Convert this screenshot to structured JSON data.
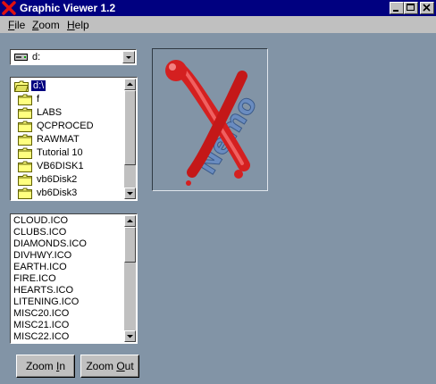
{
  "window": {
    "title": "Graphic Viewer 1.2",
    "icon": "red-x-icon"
  },
  "menu": [
    {
      "accel": "F",
      "rest": "ile"
    },
    {
      "accel": "Z",
      "rest": "oom"
    },
    {
      "accel": "H",
      "rest": "elp"
    }
  ],
  "drive": {
    "value": "d:",
    "icon": "drive-icon"
  },
  "directories": [
    "d:\\",
    "f",
    "LABS",
    "QCPROCED",
    "RAWMAT",
    "Tutorial 10",
    "VB6DISK1",
    "vb6Disk2",
    "vb6Disk3"
  ],
  "selected_directory": "d:\\",
  "files": [
    "CLOUD.ICO",
    "CLUBS.ICO",
    "DIAMONDS.ICO",
    "DIVHWY.ICO",
    "EARTH.ICO",
    "FIRE.ICO",
    "HEARTS.ICO",
    "LITENING.ICO",
    "MISC20.ICO",
    "MISC21.ICO",
    "MISC22.ICO"
  ],
  "buttons": {
    "zoom_in": {
      "pre": "Zoom ",
      "accel": "I",
      "post": "n"
    },
    "zoom_out": {
      "pre": "Zoom ",
      "accel": "O",
      "post": "ut"
    }
  },
  "picture": {
    "text": "Nemo"
  },
  "colors": {
    "titlebar": "#000080",
    "background": "#8294a6",
    "face": "#c0c0c0",
    "logo_red": "#d42020",
    "logo_blue": "#6a8cc0"
  }
}
